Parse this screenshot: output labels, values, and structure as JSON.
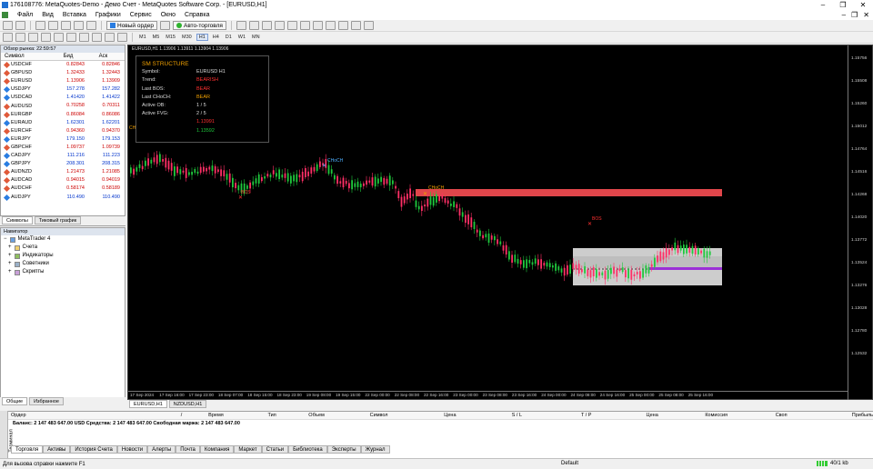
{
  "window": {
    "title": "17610877​6: MetaQuotes-Demo - Демо Счет - MetaQuotes Software Corp. - [EURUSD,H1]",
    "controls": [
      "–",
      "❐",
      "✕"
    ]
  },
  "menu": [
    "Файл",
    "Вид",
    "Вставка",
    "Графики",
    "Сервис",
    "Окно",
    "Справка"
  ],
  "toolbar": {
    "new_order": "Новый ордер",
    "auto_trading": "Авто-торговля",
    "timeframes": [
      "M1",
      "M5",
      "M15",
      "M30",
      "H1",
      "H4",
      "D1",
      "W1",
      "MN"
    ]
  },
  "market_watch": {
    "title": "Обзор рынка: 22:59:57",
    "columns": [
      "Символ",
      "Бид",
      "Аск"
    ],
    "rows": [
      {
        "symbol": "USDCHF",
        "bid": "0.82843",
        "ask": "0.82846",
        "dir": "down"
      },
      {
        "symbol": "GBPUSD",
        "bid": "1.32433",
        "ask": "1.32443",
        "dir": "down"
      },
      {
        "symbol": "EURUSD",
        "bid": "1.13906",
        "ask": "1.13909",
        "dir": "down"
      },
      {
        "symbol": "USDJPY",
        "bid": "157.278",
        "ask": "157.282",
        "dir": "up"
      },
      {
        "symbol": "USDCAD",
        "bid": "1.41420",
        "ask": "1.41422",
        "dir": "up"
      },
      {
        "symbol": "AUDUSD",
        "bid": "0.70258",
        "ask": "0.70311",
        "dir": "down"
      },
      {
        "symbol": "EURGBP",
        "bid": "0.86084",
        "ask": "0.86086",
        "dir": "down"
      },
      {
        "symbol": "EURAUD",
        "bid": "1.62301",
        "ask": "1.62201",
        "dir": "up"
      },
      {
        "symbol": "EURCHF",
        "bid": "0.94360",
        "ask": "0.94370",
        "dir": "down"
      },
      {
        "symbol": "EURJPY",
        "bid": "179.150",
        "ask": "179.153",
        "dir": "up"
      },
      {
        "symbol": "GBPCHF",
        "bid": "1.09737",
        "ask": "1.09739",
        "dir": "down"
      },
      {
        "symbol": "CADJPY",
        "bid": "111.216",
        "ask": "111.223",
        "dir": "up"
      },
      {
        "symbol": "GBPJPY",
        "bid": "208.301",
        "ask": "208.315",
        "dir": "up"
      },
      {
        "symbol": "AUDNZD",
        "bid": "1.21473",
        "ask": "1.21085",
        "dir": "down"
      },
      {
        "symbol": "AUDCAD",
        "bid": "0.94015",
        "ask": "0.94019",
        "dir": "down"
      },
      {
        "symbol": "AUDCHF",
        "bid": "0.58174",
        "ask": "0.58189",
        "dir": "down"
      },
      {
        "symbol": "AUDJPY",
        "bid": "110.490",
        "ask": "110.490",
        "dir": "up"
      }
    ],
    "tabs": [
      "Символы",
      "Тиковый график"
    ]
  },
  "navigator": {
    "title": "Навигатор",
    "root": "MetaTrader 4",
    "items": [
      "Счета",
      "Индикаторы",
      "Советники",
      "Скрипты"
    ],
    "tabs": [
      "Общие",
      "Избранное"
    ]
  },
  "chart": {
    "header": "EURUSD,H1  1.13906 1.13911 1.13904 1.13906",
    "colors": {
      "bull": "#1fc93d",
      "bear": "#ff2f66",
      "ob_red": "#e0464b",
      "fvg_gray": "#d8d8d8",
      "purple": "#9b2fd6",
      "info_text": "#f0a000"
    },
    "info_panel": {
      "title": "SM STRUCTURE",
      "symbol_label": "Symbol:",
      "symbol_value": "EURUSD H1",
      "trend_label": "Trend:",
      "trend_value": "BEARISH",
      "bos_label": "Last BOS:",
      "bos_value": "BEAR",
      "choch_label": "Last CHoCH:",
      "choch_value": "BEAR",
      "ob_label": "Active OB:",
      "ob_value": "1 / 5",
      "fvg_label": "Active FVG:",
      "fvg_value": "2 / 5",
      "price_red": "1.13991",
      "price_green": "1.13592"
    },
    "annotations": {
      "choch_1": "CHoCH",
      "choch_2": "CHoCH",
      "bos_1": "BOS",
      "bos_2": "BOS",
      "ch": "CH"
    },
    "price_axis": [
      "1.15756",
      "1.15508",
      "1.15260",
      "1.15012",
      "1.14764",
      "1.14516",
      "1.14268",
      "1.14020",
      "1.13772",
      "1.13524",
      "1.13276",
      "1.13028",
      "1.12780",
      "1.12532"
    ],
    "time_axis": [
      "17 Sep 2024",
      "17 Sep 16:00",
      "17 Sep 23:00",
      "18 Sep 07:00",
      "18 Sep 15:00",
      "18 Sep 23:00",
      "19 Sep 08:00",
      "19 Sep 15:00",
      "22 Sep 00:00",
      "22 Sep 08:00",
      "22 Sep 16:00",
      "23 Sep 00:00",
      "23 Sep 08:00",
      "23 Sep 16:00",
      "24 Sep 00:00",
      "24 Sep 08:00",
      "24 Sep 16:00",
      "25 Sep 00:00",
      "25 Sep 08:00",
      "25 Sep 16:00"
    ],
    "tabs": [
      "EURUSD,H1",
      "NZDUSD,H1"
    ]
  },
  "terminal": {
    "side_label": "Терминал",
    "columns": [
      "Ордер",
      "/",
      "Время",
      "Тип",
      "Объем",
      "Символ",
      "Цена",
      "S / L",
      "T / P",
      "Цена",
      "Комиссия",
      "Своп",
      "Прибыль"
    ],
    "balance": "Баланс: 2 147 483 647.00 USD  Средства: 2 147 483 647.00  Свободная маржа: 2 147 483 647.00",
    "tabs": [
      "Торговля",
      "Активы",
      "История Счета",
      "Новости",
      "Алерты",
      "Почта",
      "Компания",
      "Маркет",
      "Статьи",
      "Библиотека",
      "Эксперты",
      "Журнал"
    ]
  },
  "status": {
    "help": "Для вызова справки нажмите F1",
    "profile": "Default",
    "traffic": "40/1 kb"
  }
}
